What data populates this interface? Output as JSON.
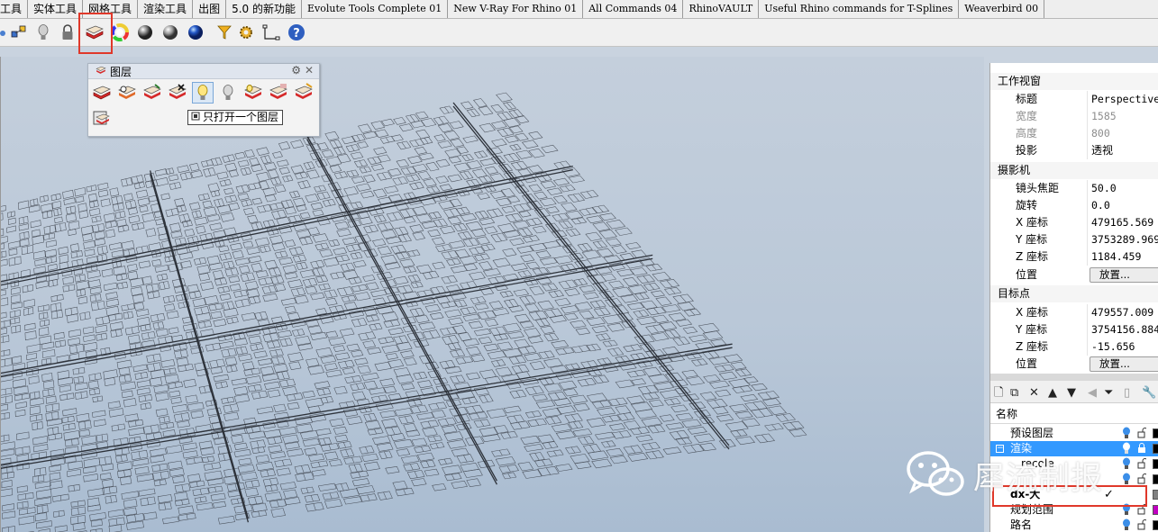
{
  "tabs": [
    "工具",
    "实体工具",
    "网格工具",
    "渲染工具",
    "出图",
    "5.0 的新功能",
    "Evolute Tools Complete 01",
    "New V-Ray For Rhino 01",
    "All Commands 04",
    "RhinoVAULT",
    "Useful Rhino commands for T-Splines",
    "Weaverbird 00"
  ],
  "toolbar": {
    "icons": [
      "snap-points-icon",
      "lightbulb-icon",
      "lock-icon",
      "layer-icon",
      "color-wheel-icon",
      "sphere-shaded-icon",
      "sphere-rendered-icon",
      "sphere-blue-icon",
      "select-filter-icon",
      "gear-settings-icon",
      "dimension-icon",
      "help-icon"
    ],
    "highlighted": "layer-icon"
  },
  "layer_panel": {
    "title": "图层",
    "tooltip": "只打开一个图层",
    "buttons": [
      "layer-icon",
      "layer-visible-icon",
      "layer-current-icon",
      "layer-off-icon",
      "lightbulb-on-icon",
      "lightbulb-off-icon",
      "layer-lock-icon",
      "layer-change-icon",
      "layer-match-icon",
      "layer-settings-icon"
    ]
  },
  "properties": {
    "section_viewport": "工作视窗",
    "title_label": "标题",
    "title_value": "Perspective",
    "width_label": "宽度",
    "width_value": "1585",
    "height_label": "高度",
    "height_value": "800",
    "projection_label": "投影",
    "projection_value": "透视",
    "section_camera": "摄影机",
    "lens_label": "镜头焦距",
    "lens_value": "50.0",
    "rotate_label": "旋转",
    "rotate_value": "0.0",
    "cam_x_label": "X 座标",
    "cam_x_value": "479165.569",
    "cam_y_label": "Y 座标",
    "cam_y_value": "3753289.969",
    "cam_z_label": "Z 座标",
    "cam_z_value": "1184.459",
    "cam_pos_label": "位置",
    "cam_pos_button": "放置...",
    "section_target": "目标点",
    "tgt_x_label": "X 座标",
    "tgt_x_value": "479557.009",
    "tgt_y_label": "Y 座标",
    "tgt_y_value": "3754156.884",
    "tgt_z_label": "Z 座标",
    "tgt_z_value": "-15.656",
    "tgt_pos_label": "位置",
    "tgt_pos_button": "放置..."
  },
  "layers": {
    "header": "名称",
    "rows": [
      {
        "name": "预设图层",
        "color": "#000000",
        "selected": false
      },
      {
        "name": "渲染",
        "color": "#000000",
        "selected": true
      },
      {
        "name": "recole",
        "color": "#000000",
        "selected": false
      },
      {
        "name": "",
        "color": "#000000",
        "selected": false
      },
      {
        "name": "dx-大",
        "color": "#808080",
        "selected": false,
        "current": true
      },
      {
        "name": "规划范围",
        "color": "#c000c0",
        "selected": false
      },
      {
        "name": "路名",
        "color": "#000000",
        "selected": false
      }
    ],
    "highlighted_layer": "dx-大"
  },
  "watermark": "犀流制报"
}
